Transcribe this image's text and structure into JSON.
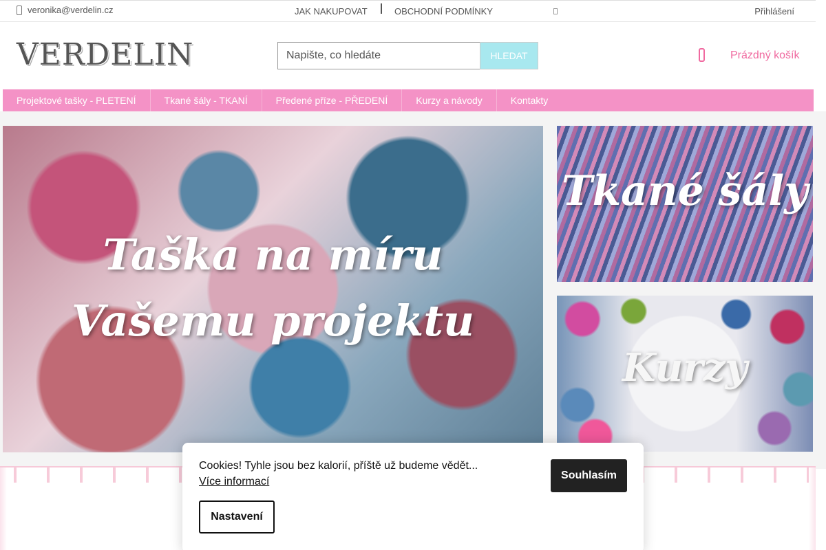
{
  "topbar": {
    "email": "veronika@verdelin.cz",
    "email_icon": "phone-icon",
    "links": [
      "JAK NAKUPOVAT",
      "OBCHODNÍ PODMÍNKY"
    ],
    "more_icon": "chevron-icon",
    "login": "Přihlášení"
  },
  "header": {
    "logo": "VERDELIN",
    "search_placeholder": "Napište, co hledáte",
    "search_button": "HLEDAT",
    "cart_icon": "cart-icon",
    "cart_label": "Prázdný košík"
  },
  "menu": {
    "items": [
      "Projektové tašky - PLETENÍ",
      "Tkané šály - TKANÍ",
      "Předené příze - PŘEDENÍ",
      "Kurzy a návody",
      "Kontakty"
    ]
  },
  "banners": {
    "main": "Taška na míru Vašemu projektu",
    "top_right": "Tkané šály",
    "bottom_right": "Kurzy"
  },
  "cookie": {
    "message": "Cookies! Tyhle jsou bez kalorií, příště už budeme vědět...",
    "more": "Více informací",
    "agree": "Souhlasím",
    "settings": "Nastavení"
  },
  "colors": {
    "brand_pink": "#f492c6",
    "accent_cyan": "#a8e8ef",
    "cart_pink": "#f06aa0"
  }
}
